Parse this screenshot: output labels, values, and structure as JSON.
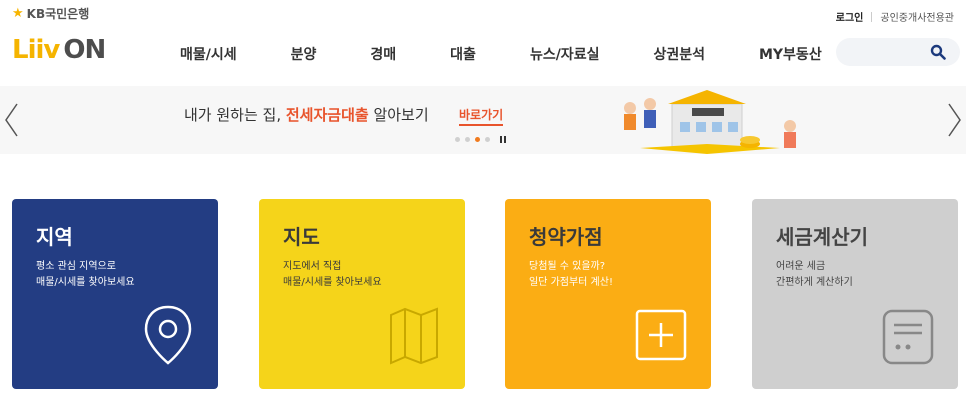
{
  "top": {
    "kb_logo_text": "KB국민은행",
    "login": "로그인",
    "agent_link": "공인중개사전용관"
  },
  "nav": {
    "logo_part1": "Liiv",
    "logo_part2": "ON",
    "items": [
      "매물/시세",
      "분양",
      "경매",
      "대출",
      "뉴스/자료실",
      "상권분석",
      "MY부동산"
    ],
    "search_placeholder": ""
  },
  "banner": {
    "text_before": "내가 원하는 집, ",
    "text_highlight": "전세자금대출",
    "text_after": " 알아보기",
    "link": "바로가기",
    "dot_count": 4,
    "active_dot": 2,
    "accent": "#e8542c"
  },
  "cards": [
    {
      "title": "지역",
      "desc": [
        "평소 관심 지역으로",
        "매물/시세를 찾아보세요"
      ],
      "icon": "location-pin-icon",
      "color": "#233d83"
    },
    {
      "title": "지도",
      "desc": [
        "지도에서 직접",
        "매물/시세를 찾아보세요"
      ],
      "icon": "map-icon",
      "color": "#f5d41a"
    },
    {
      "title": "청약가점",
      "desc": [
        "당첨될 수 있을까?",
        "일단 가점부터 계산!"
      ],
      "icon": "plus-box-icon",
      "color": "#fbad14"
    },
    {
      "title": "세금계산기",
      "desc": [
        "어려운 세금",
        "간편하게 계산하기"
      ],
      "icon": "calculator-icon",
      "color": "#cfcfcf"
    }
  ]
}
